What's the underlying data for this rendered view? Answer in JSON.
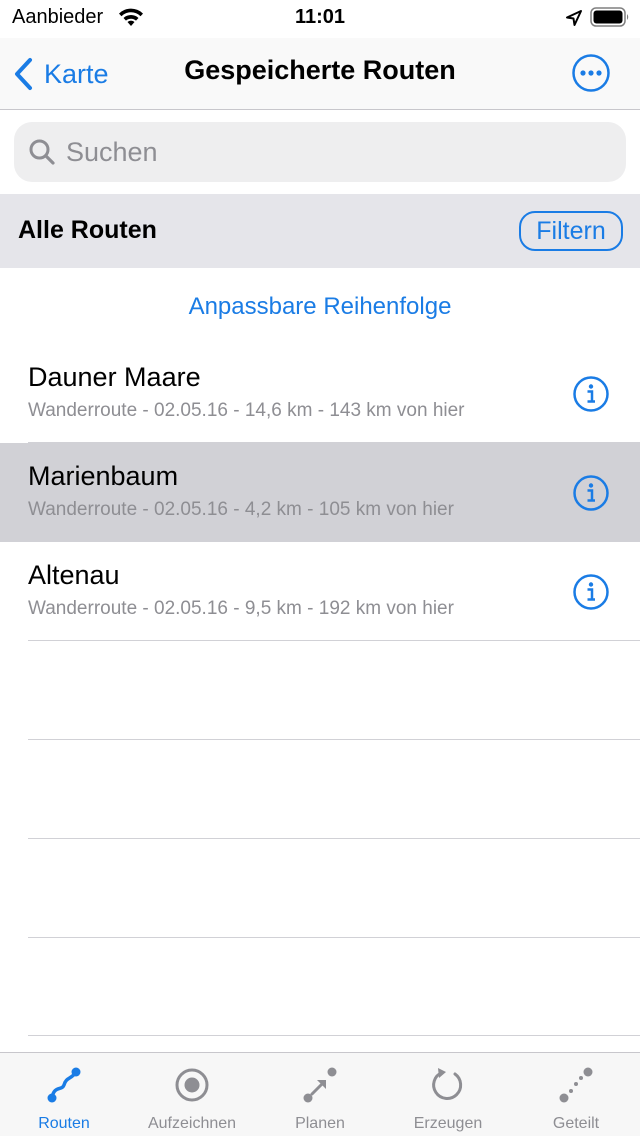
{
  "status_bar": {
    "carrier": "Aanbieder",
    "time": "11:01"
  },
  "nav": {
    "back_label": "Karte",
    "title": "Gespeicherte Routen",
    "more_icon": "ellipsis-circle-icon"
  },
  "search": {
    "value": "",
    "placeholder": "Suchen"
  },
  "section": {
    "title": "Alle Routen",
    "filter_label": "Filtern"
  },
  "sort_link": "Anpassbare Reihenfolge",
  "routes": [
    {
      "name": "Dauner Maare",
      "meta": "Wanderroute - 02.05.16 - 14,6 km - 143 km von hier",
      "selected": false
    },
    {
      "name": "Marienbaum",
      "meta": "Wanderroute - 02.05.16 - 4,2 km - 105 km von hier",
      "selected": true
    },
    {
      "name": "Altenau",
      "meta": "Wanderroute - 02.05.16 - 9,5 km - 192 km von hier",
      "selected": false
    }
  ],
  "tabs": [
    {
      "label": "Routen",
      "icon": "route-icon",
      "active": true
    },
    {
      "label": "Aufzeichnen",
      "icon": "record-icon",
      "active": false
    },
    {
      "label": "Planen",
      "icon": "plan-icon",
      "active": false
    },
    {
      "label": "Erzeugen",
      "icon": "generate-icon",
      "active": false
    },
    {
      "label": "Geteilt",
      "icon": "shared-icon",
      "active": false
    }
  ],
  "colors": {
    "accent": "#1a7ce5",
    "inactive": "#8e8e93",
    "selected_row": "#d1d1d6",
    "section_bg": "#e5e5ea"
  }
}
